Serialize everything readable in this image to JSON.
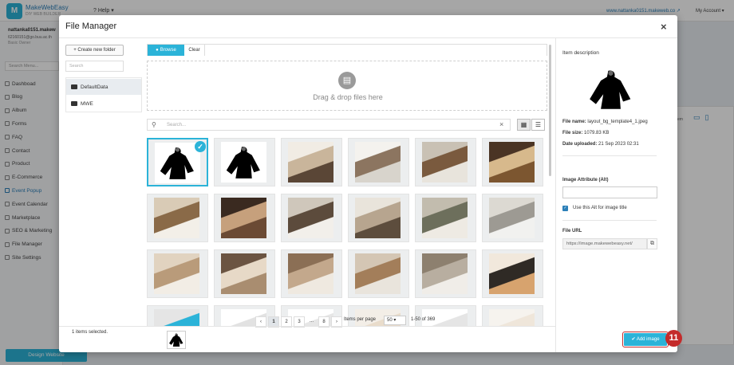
{
  "app": {
    "logo_letter": "M",
    "brand": "MakeWebEasy",
    "brand_sub": "DIY WEB BUILDER",
    "help": "Help",
    "site_link": "www.nattanka0151.makeweb.co",
    "account": "My Account"
  },
  "sidebar": {
    "user_name": "nattanka0151.makew",
    "user_email": "62160151@go.buu.ac.th",
    "user_plan": "Basic Owner",
    "search_placeholder": "Search Menu...",
    "items": [
      {
        "label": "Dashboad",
        "icon": "dashboard-icon"
      },
      {
        "label": "Blog",
        "icon": "blog-icon"
      },
      {
        "label": "Album",
        "icon": "album-icon"
      },
      {
        "label": "Forms",
        "icon": "forms-icon"
      },
      {
        "label": "FAQ",
        "icon": "faq-icon"
      },
      {
        "label": "Contact",
        "icon": "contact-icon"
      },
      {
        "label": "Product",
        "icon": "product-icon"
      },
      {
        "label": "E-Commerce",
        "icon": "cart-icon"
      },
      {
        "label": "Event Popup",
        "icon": "megaphone-icon",
        "active": true
      },
      {
        "label": "Event Calendar",
        "icon": "calendar-icon"
      },
      {
        "label": "Marketplace",
        "icon": "store-icon"
      },
      {
        "label": "SEO & Marketing",
        "icon": "seo-icon"
      },
      {
        "label": "File Manager",
        "icon": "folder-icon"
      },
      {
        "label": "Site Settings",
        "icon": "gear-icon"
      }
    ],
    "design_button": "Design Website"
  },
  "bg_panel": {
    "text": "em"
  },
  "modal": {
    "title": "File Manager",
    "close": "×",
    "new_folder": "Create new folder",
    "folder_search_placeholder": "Search",
    "folders": [
      {
        "label": "DefaultData",
        "selected": true
      },
      {
        "label": "MWE",
        "selected": false
      }
    ],
    "tabs": {
      "browse": "Browse",
      "clear": "Clear"
    },
    "dropzone_text": "Drag & drop files here",
    "search_placeholder": "Search...",
    "clear_search": "×",
    "pagination": {
      "prev": "‹",
      "pages": [
        "1",
        "2",
        "3",
        "...",
        "8"
      ],
      "next": "›",
      "current": "1",
      "items_per_page_label": "Items per page",
      "items_per_page": "50",
      "range": "1-50 of 369"
    },
    "selected_count": "1 items selected.",
    "details": {
      "heading": "Item description",
      "file_name_label": "File name:",
      "file_name": "layout_bg_template4_1.jpeg",
      "file_size_label": "File size:",
      "file_size": "1079.83 KB",
      "uploaded_label": "Date uploaded:",
      "uploaded": "21 Sep 2023 02:31",
      "alt_label": "Image Attribute (Alt)",
      "alt_value": "",
      "use_alt_label": "Use this Alt for image title",
      "use_alt_checked": true,
      "file_url_label": "File URL",
      "file_url": "https://image.makewebeasy.net/"
    },
    "add_image": "Add image",
    "step_badge": "11"
  },
  "thumbnails": [
    {
      "kind": "silhouette",
      "selected": true
    },
    {
      "kind": "silhouette",
      "selected": false
    },
    {
      "kind": "photo",
      "palette": [
        "#5a4636",
        "#c9b59b",
        "#f1ece4"
      ]
    },
    {
      "kind": "photo",
      "palette": [
        "#d8d4cc",
        "#8c7560",
        "#f4f2ee"
      ]
    },
    {
      "kind": "photo",
      "palette": [
        "#e8e4dc",
        "#7a5a3e",
        "#c9c1b4"
      ]
    },
    {
      "kind": "photo",
      "palette": [
        "#7c5630",
        "#d7b98c",
        "#4a3424"
      ]
    },
    {
      "kind": "photo",
      "palette": [
        "#f3efe8",
        "#8a6a48",
        "#d9cbb6"
      ]
    },
    {
      "kind": "photo",
      "palette": [
        "#6b4a34",
        "#c6a07c",
        "#3a2a20"
      ]
    },
    {
      "kind": "photo",
      "palette": [
        "#f2efea",
        "#5c4b3c",
        "#cfc7bb"
      ]
    },
    {
      "kind": "photo",
      "palette": [
        "#5d4d3d",
        "#b7a58f",
        "#e9e4db"
      ]
    },
    {
      "kind": "photo",
      "palette": [
        "#eeeae3",
        "#6d6f5c",
        "#c2bcae"
      ]
    },
    {
      "kind": "photo",
      "palette": [
        "#f1f1ef",
        "#9d9a93",
        "#dcd9d2"
      ]
    },
    {
      "kind": "photo",
      "palette": [
        "#f2ede5",
        "#b99b7a",
        "#e1d3c0"
      ]
    },
    {
      "kind": "photo",
      "palette": [
        "#a98d70",
        "#e7d9c7",
        "#6b5442"
      ]
    },
    {
      "kind": "photo",
      "palette": [
        "#efe9e0",
        "#c3a88c",
        "#8b6f55"
      ]
    },
    {
      "kind": "photo",
      "palette": [
        "#e9e4dc",
        "#a37e5a",
        "#d4c6b4"
      ]
    },
    {
      "kind": "photo",
      "palette": [
        "#f0ede8",
        "#b8aea0",
        "#8d806f"
      ]
    },
    {
      "kind": "photo",
      "palette": [
        "#d7a36e",
        "#2f2a25",
        "#f1e8dc"
      ]
    },
    {
      "kind": "photo",
      "palette": [
        "#ffffff",
        "#2bb3d8",
        "#e5e5e5"
      ]
    },
    {
      "kind": "photo",
      "palette": [
        "#f0f0f0",
        "#e2e2e2",
        "#ffffff"
      ]
    },
    {
      "kind": "photo",
      "palette": [
        "#f2f2f2",
        "#e6e6e6",
        "#ffffff"
      ]
    },
    {
      "kind": "photo",
      "palette": [
        "#c7a07e",
        "#e9dccb",
        "#f3eee7"
      ]
    },
    {
      "kind": "photo",
      "palette": [
        "#f3f3f3",
        "#e5e5e5",
        "#ffffff"
      ]
    },
    {
      "kind": "photo",
      "palette": [
        "#d9c3aa",
        "#efe6da",
        "#f6f3ee"
      ]
    }
  ],
  "colors": {
    "accent": "#2bb3d8",
    "link": "#2b7fb8",
    "highlight": "#c42b2b"
  }
}
